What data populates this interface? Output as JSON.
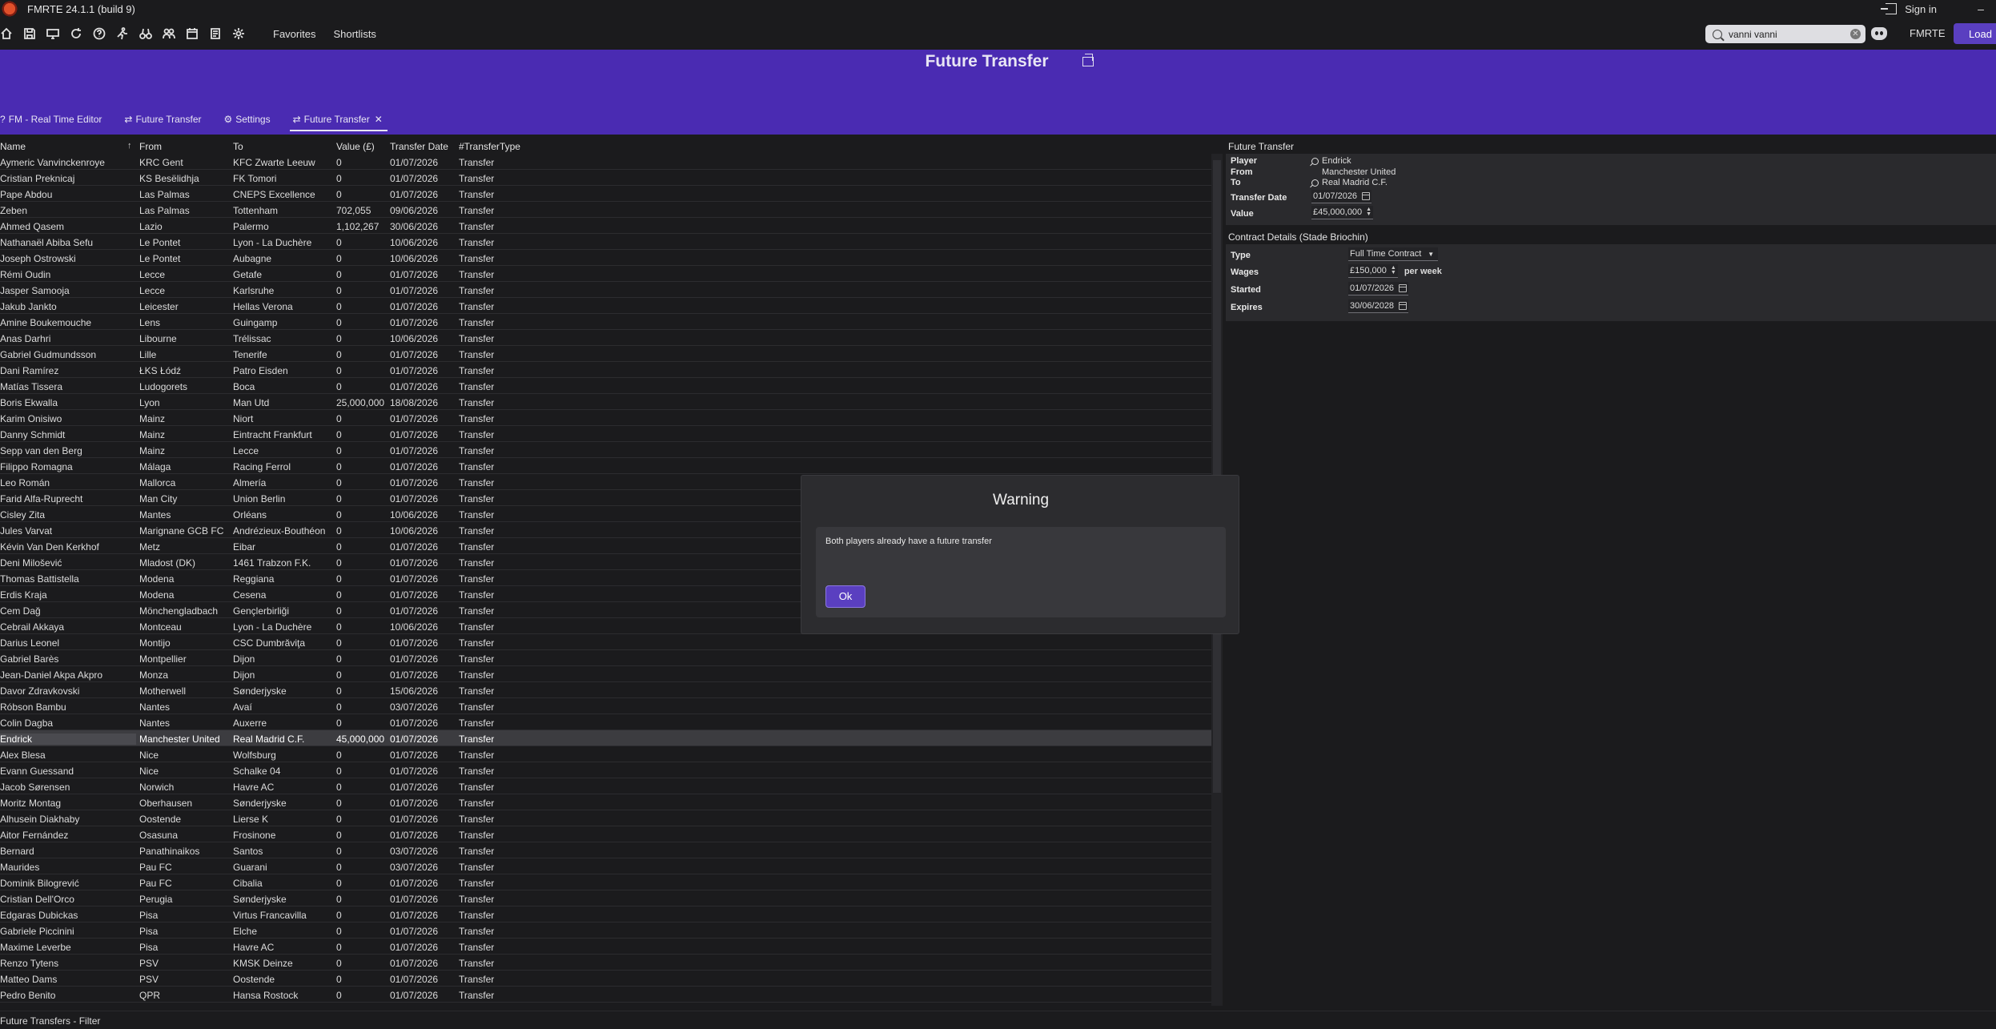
{
  "app": {
    "title": "FMRTE 24.1.1 (build 9)",
    "signin": "Sign in",
    "minimize": "–"
  },
  "toolbar": {
    "favorites": "Favorites",
    "shortlists": "Shortlists",
    "search_value": "vanni vanni",
    "fmrte": "FMRTE",
    "load": "Load"
  },
  "header": {
    "title": "Future Transfer",
    "tabs": [
      {
        "icon": "?",
        "label": "FM - Real Time Editor"
      },
      {
        "icon": "⇄",
        "label": "Future Transfer"
      },
      {
        "icon": "⚙",
        "label": "Settings"
      },
      {
        "icon": "⇄",
        "label": "Future Transfer",
        "close": "✕"
      }
    ]
  },
  "grid": {
    "columns": {
      "name": "Name",
      "from": "From",
      "to": "To",
      "value": "Value (£)",
      "date": "Transfer Date",
      "type": "#TransferType"
    },
    "rows": [
      [
        "Aymeric Vanvinckenroye",
        "KRC Gent",
        "KFC Zwarte Leeuw",
        "0",
        "01/07/2026",
        "Transfer"
      ],
      [
        "Cristian Preknicaj",
        "KS Besëlidhja",
        "FK Tomori",
        "0",
        "01/07/2026",
        "Transfer"
      ],
      [
        "Pape Abdou",
        "Las Palmas",
        "CNEPS Excellence",
        "0",
        "01/07/2026",
        "Transfer"
      ],
      [
        "Zeben",
        "Las Palmas",
        "Tottenham",
        "702,055",
        "09/06/2026",
        "Transfer"
      ],
      [
        "Ahmed Qasem",
        "Lazio",
        "Palermo",
        "1,102,267",
        "30/06/2026",
        "Transfer"
      ],
      [
        "Nathanaël Abiba Sefu",
        "Le Pontet",
        "Lyon - La Duchère",
        "0",
        "10/06/2026",
        "Transfer"
      ],
      [
        "Joseph Ostrowski",
        "Le Pontet",
        "Aubagne",
        "0",
        "10/06/2026",
        "Transfer"
      ],
      [
        "Rémi Oudin",
        "Lecce",
        "Getafe",
        "0",
        "01/07/2026",
        "Transfer"
      ],
      [
        "Jasper Samooja",
        "Lecce",
        "Karlsruhe",
        "0",
        "01/07/2026",
        "Transfer"
      ],
      [
        "Jakub Jankto",
        "Leicester",
        "Hellas Verona",
        "0",
        "01/07/2026",
        "Transfer"
      ],
      [
        "Amine Boukemouche",
        "Lens",
        "Guingamp",
        "0",
        "01/07/2026",
        "Transfer"
      ],
      [
        "Anas Darhri",
        "Libourne",
        "Trélissac",
        "0",
        "10/06/2026",
        "Transfer"
      ],
      [
        "Gabriel Gudmundsson",
        "Lille",
        "Tenerife",
        "0",
        "01/07/2026",
        "Transfer"
      ],
      [
        "Dani Ramírez",
        "ŁKS Łódź",
        "Patro Eisden",
        "0",
        "01/07/2026",
        "Transfer"
      ],
      [
        "Matías Tissera",
        "Ludogorets",
        "Boca",
        "0",
        "01/07/2026",
        "Transfer"
      ],
      [
        "Boris Ekwalla",
        "Lyon",
        "Man Utd",
        "25,000,000",
        "18/08/2026",
        "Transfer"
      ],
      [
        "Karim Onisiwo",
        "Mainz",
        "Niort",
        "0",
        "01/07/2026",
        "Transfer"
      ],
      [
        "Danny Schmidt",
        "Mainz",
        "Eintracht Frankfurt",
        "0",
        "01/07/2026",
        "Transfer"
      ],
      [
        "Sepp van den Berg",
        "Mainz",
        "Lecce",
        "0",
        "01/07/2026",
        "Transfer"
      ],
      [
        "Filippo Romagna",
        "Málaga",
        "Racing Ferrol",
        "0",
        "01/07/2026",
        "Transfer"
      ],
      [
        "Leo Román",
        "Mallorca",
        "Almería",
        "0",
        "01/07/2026",
        "Transfer"
      ],
      [
        "Farid Alfa-Ruprecht",
        "Man City",
        "Union Berlin",
        "0",
        "01/07/2026",
        "Transfer"
      ],
      [
        "Cisley Zita",
        "Mantes",
        "Orléans",
        "0",
        "10/06/2026",
        "Transfer"
      ],
      [
        "Jules Varvat",
        "Marignane GCB FC",
        "Andrézieux-Bouthéon",
        "0",
        "10/06/2026",
        "Transfer"
      ],
      [
        "Kévin Van Den Kerkhof",
        "Metz",
        "Eibar",
        "0",
        "01/07/2026",
        "Transfer"
      ],
      [
        "Deni Milošević",
        "Mladost (DK)",
        "1461 Trabzon F.K.",
        "0",
        "01/07/2026",
        "Transfer"
      ],
      [
        "Thomas Battistella",
        "Modena",
        "Reggiana",
        "0",
        "01/07/2026",
        "Transfer"
      ],
      [
        "Erdis Kraja",
        "Modena",
        "Cesena",
        "0",
        "01/07/2026",
        "Transfer"
      ],
      [
        "Cem Dağ",
        "Mönchengladbach",
        "Gençlerbirliği",
        "0",
        "01/07/2026",
        "Transfer"
      ],
      [
        "Cebrail Akkaya",
        "Montceau",
        "Lyon - La Duchère",
        "0",
        "10/06/2026",
        "Transfer"
      ],
      [
        "Darius Leonel",
        "Montijo",
        "CSC Dumbrăviţa",
        "0",
        "01/07/2026",
        "Transfer"
      ],
      [
        "Gabriel Barès",
        "Montpellier",
        "Dijon",
        "0",
        "01/07/2026",
        "Transfer"
      ],
      [
        "Jean-Daniel Akpa Akpro",
        "Monza",
        "Dijon",
        "0",
        "01/07/2026",
        "Transfer"
      ],
      [
        "Davor Zdravkovski",
        "Motherwell",
        "Sønderjyske",
        "0",
        "15/06/2026",
        "Transfer"
      ],
      [
        "Róbson Bambu",
        "Nantes",
        "Avaí",
        "0",
        "03/07/2026",
        "Transfer"
      ],
      [
        "Colin Dagba",
        "Nantes",
        "Auxerre",
        "0",
        "01/07/2026",
        "Transfer"
      ],
      [
        "Endrick",
        "Manchester United",
        "Real Madrid C.F.",
        "45,000,000",
        "01/07/2026",
        "Transfer"
      ],
      [
        "Alex Blesa",
        "Nice",
        "Wolfsburg",
        "0",
        "01/07/2026",
        "Transfer"
      ],
      [
        "Evann Guessand",
        "Nice",
        "Schalke 04",
        "0",
        "01/07/2026",
        "Transfer"
      ],
      [
        "Jacob Sørensen",
        "Norwich",
        "Havre AC",
        "0",
        "01/07/2026",
        "Transfer"
      ],
      [
        "Moritz Montag",
        "Oberhausen",
        "Sønderjyske",
        "0",
        "01/07/2026",
        "Transfer"
      ],
      [
        "Alhusein Diakhaby",
        "Oostende",
        "Lierse K",
        "0",
        "01/07/2026",
        "Transfer"
      ],
      [
        "Aitor Fernández",
        "Osasuna",
        "Frosinone",
        "0",
        "01/07/2026",
        "Transfer"
      ],
      [
        "Bernard",
        "Panathinaikos",
        "Santos",
        "0",
        "03/07/2026",
        "Transfer"
      ],
      [
        "Maurides",
        "Pau FC",
        "Guarani",
        "0",
        "03/07/2026",
        "Transfer"
      ],
      [
        "Dominik Bilogrević",
        "Pau FC",
        "Cibalia",
        "0",
        "01/07/2026",
        "Transfer"
      ],
      [
        "Cristian Dell'Orco",
        "Perugia",
        "Sønderjyske",
        "0",
        "01/07/2026",
        "Transfer"
      ],
      [
        "Edgaras Dubickas",
        "Pisa",
        "Virtus Francavilla",
        "0",
        "01/07/2026",
        "Transfer"
      ],
      [
        "Gabriele Piccinini",
        "Pisa",
        "Elche",
        "0",
        "01/07/2026",
        "Transfer"
      ],
      [
        "Maxime Leverbe",
        "Pisa",
        "Havre AC",
        "0",
        "01/07/2026",
        "Transfer"
      ],
      [
        "Renzo Tytens",
        "PSV",
        "KMSK Deinze",
        "0",
        "01/07/2026",
        "Transfer"
      ],
      [
        "Matteo Dams",
        "PSV",
        "Oostende",
        "0",
        "01/07/2026",
        "Transfer"
      ],
      [
        "Pedro Benito",
        "QPR",
        "Hansa Rostock",
        "0",
        "01/07/2026",
        "Transfer"
      ]
    ],
    "selected_index": 36
  },
  "panel": {
    "future_transfer": {
      "heading": "Future Transfer",
      "player_label": "Player",
      "player": "Endrick",
      "from_label": "From",
      "from": "Manchester United",
      "to_label": "To",
      "to": "Real Madrid C.F.",
      "date_label": "Transfer Date",
      "date": "01/07/2026",
      "value_label": "Value",
      "value": "£45,000,000"
    },
    "contract": {
      "heading": "Contract Details (Stade Briochin)",
      "type_label": "Type",
      "type": "Full Time Contract",
      "wages_label": "Wages",
      "wages": "£150,000",
      "per": "per week",
      "started_label": "Started",
      "started": "01/07/2026",
      "expires_label": "Expires",
      "expires": "30/06/2028"
    }
  },
  "modal": {
    "title": "Warning",
    "message": "Both players already have a future transfer",
    "ok": "Ok"
  },
  "status": {
    "text": "Future Transfers - Filter"
  },
  "colors": {
    "accent": "#4a2bb2",
    "button": "#5a3fc0",
    "background": "#1b1b1d"
  }
}
